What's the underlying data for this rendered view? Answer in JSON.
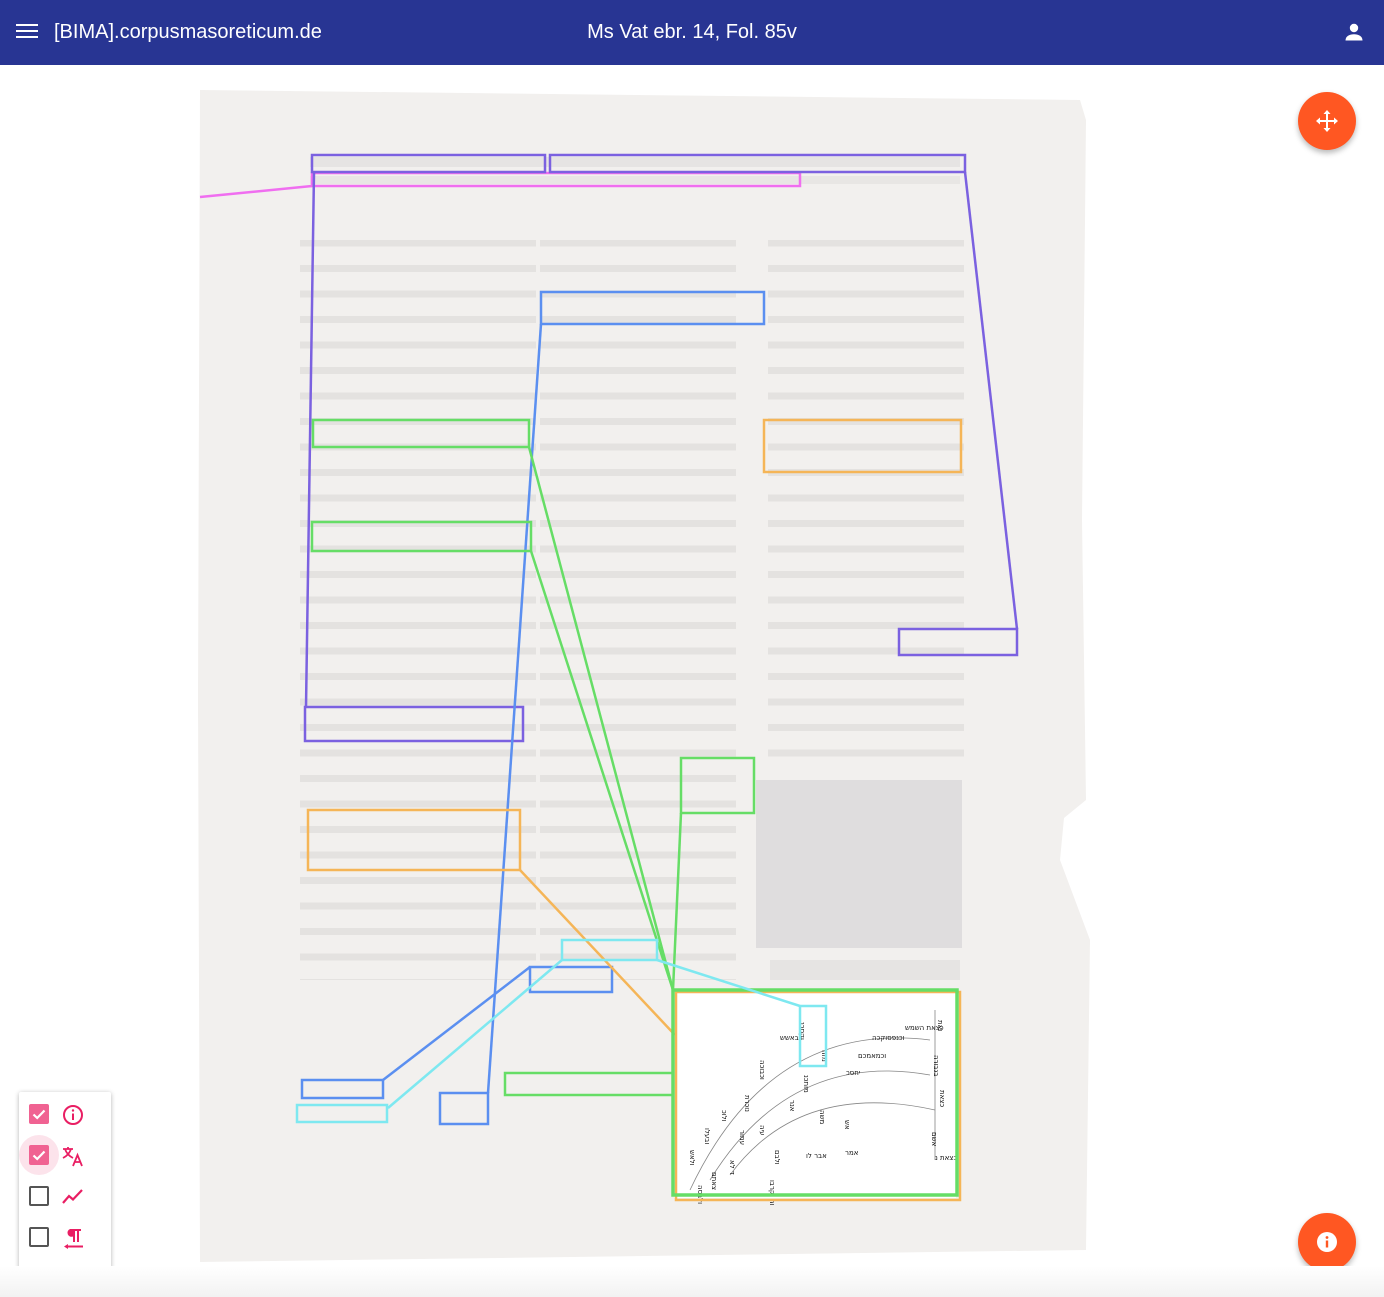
{
  "app": {
    "site_title": "[BIMA].corpusmasoreticum.de",
    "page_title": "Ms Vat ebr. 14, Fol. 85v"
  },
  "icons": {
    "menu": "menu-icon",
    "account": "account-icon",
    "move": "move-arrows-icon",
    "info": "info-icon"
  },
  "colors": {
    "appbar": "#283593",
    "fab": "#ff5722",
    "checkbox_on": "#f06292",
    "layer_icon": "#e91e63",
    "annotation_purple": "#7b61e0",
    "annotation_magenta": "#f06ef0",
    "annotation_blue": "#5b8ff0",
    "annotation_green": "#66dd66",
    "annotation_orange": "#f5b557",
    "annotation_cyan": "#7ee8f0"
  },
  "layers": [
    {
      "icon": "info-circle-icon",
      "checked": true
    },
    {
      "icon": "translate-icon",
      "checked": true
    },
    {
      "icon": "trend-line-icon",
      "checked": false
    },
    {
      "icon": "paragraph-icon",
      "checked": false
    }
  ],
  "diagram_labels": [
    "ואת",
    "וכנפסוקכה",
    "כצאת השמש",
    "בגבורה",
    "וכמאמכם",
    "מזה",
    "מותכנ",
    "יחסכ",
    "משה",
    "אנר",
    "אבר לו",
    "נוכרת",
    "וכבוכה",
    "ויבאשש",
    "וקסכנ",
    "כצאת",
    "אשם",
    "ולוכ",
    "ובעלו",
    "ולאש",
    "עמור",
    "עיה",
    "ולבם",
    "אמר",
    "אש",
    "ד לא",
    "צאתם",
    "ולבסה",
    "וה וקרבו",
    "כצאת נ"
  ]
}
